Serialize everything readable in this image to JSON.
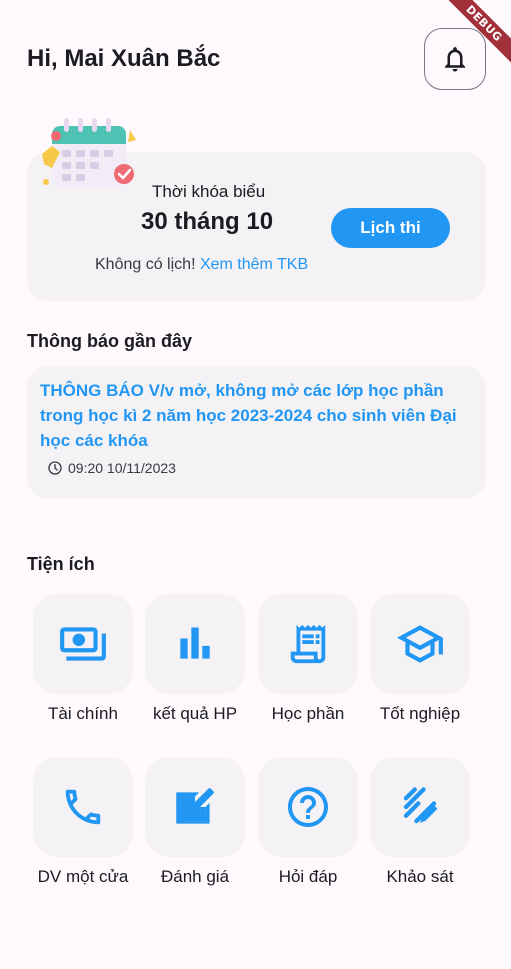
{
  "debug_banner": "DEBUG",
  "header": {
    "greeting": "Hi, Mai Xuân Bắc"
  },
  "schedule": {
    "title": "Thời khóa biểu",
    "date": "30 tháng 10",
    "exam_button": "Lịch thi",
    "no_schedule": "Không có lịch! ",
    "more_link": "Xem thêm TKB"
  },
  "notices": {
    "section_title": "Thông báo gần đây",
    "items": [
      {
        "title": "THÔNG BÁO V/v mở, không mở các lớp học phần trong học kì 2 năm học 2023-2024 cho sinh viên Đại học các khóa",
        "time": "09:20 10/11/2023"
      }
    ]
  },
  "utilities": {
    "section_title": "Tiện ích",
    "items": [
      {
        "label": "Tài chính",
        "icon": "money-icon"
      },
      {
        "label": "kết quả HP",
        "icon": "bar-chart-icon"
      },
      {
        "label": "Học phần",
        "icon": "receipt-icon"
      },
      {
        "label": "Tốt nghiệp",
        "icon": "graduation-cap-icon"
      },
      {
        "label": "DV một cửa",
        "icon": "phone-icon"
      },
      {
        "label": "Đánh giá",
        "icon": "edit-icon"
      },
      {
        "label": "Hỏi đáp",
        "icon": "help-icon"
      },
      {
        "label": "Khảo sát",
        "icon": "draw-icon"
      }
    ]
  },
  "colors": {
    "accent": "#2196f3",
    "card": "#f4f2f5",
    "background": "#fdf9fd"
  }
}
